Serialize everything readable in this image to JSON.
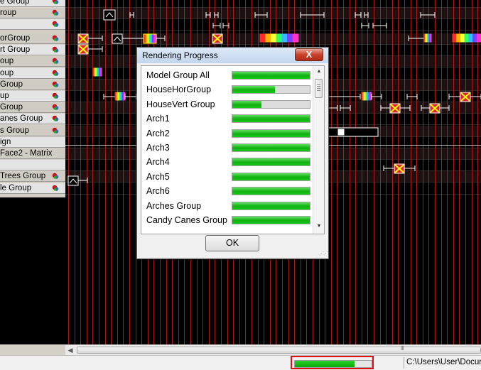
{
  "model_list": {
    "rows": [
      {
        "label": "e Group",
        "has_icon": true
      },
      {
        "label": "roup",
        "has_icon": true
      },
      {
        "label": "",
        "has_icon": true
      },
      {
        "label": "orGroup",
        "has_icon": true
      },
      {
        "label": "rt Group",
        "has_icon": true
      },
      {
        "label": "oup",
        "has_icon": true
      },
      {
        "label": "oup",
        "has_icon": true
      },
      {
        "label": "Group",
        "has_icon": true
      },
      {
        "label": "up",
        "has_icon": true
      },
      {
        "label": "Group",
        "has_icon": true
      },
      {
        "label": "anes Group",
        "has_icon": true
      },
      {
        "label": "s Group",
        "has_icon": true
      },
      {
        "label": "ign",
        "has_icon": false
      },
      {
        "label": "Face2 - Matrix",
        "has_icon": false
      },
      {
        "label": "",
        "has_icon": false
      },
      {
        "label": "Trees Group",
        "has_icon": true
      },
      {
        "label": "le Group",
        "has_icon": true
      }
    ]
  },
  "dialog": {
    "title": "Rendering Progress",
    "close_label": "X",
    "ok_label": "OK",
    "items": [
      {
        "name": "Model Group All",
        "progress": 1.0
      },
      {
        "name": "HouseHorGroup",
        "progress": 0.55
      },
      {
        "name": "HouseVert Group",
        "progress": 0.38
      },
      {
        "name": "Arch1",
        "progress": 1.0
      },
      {
        "name": "Arch2",
        "progress": 1.0
      },
      {
        "name": "Arch3",
        "progress": 1.0
      },
      {
        "name": "Arch4",
        "progress": 1.0
      },
      {
        "name": "Arch5",
        "progress": 1.0
      },
      {
        "name": "Arch6",
        "progress": 1.0
      },
      {
        "name": "Arches Group",
        "progress": 1.0
      },
      {
        "name": "Candy Canes Group",
        "progress": 1.0
      }
    ]
  },
  "status_bar": {
    "overall_progress": 0.78,
    "path": "C:\\Users\\User\\Docur"
  },
  "scrollbar": {
    "grip": "III"
  },
  "colors": {
    "grid_line": "#c81e1e",
    "row_band": "#1c1010",
    "progress_green": "#10b010",
    "highlight": "#e01010"
  }
}
